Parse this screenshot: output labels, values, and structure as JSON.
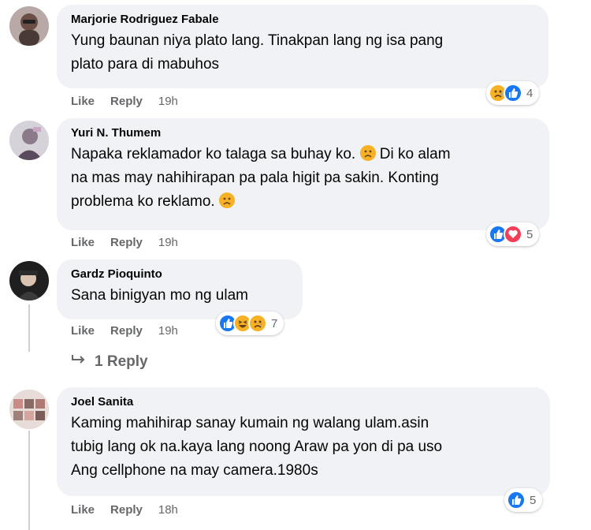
{
  "comments": [
    {
      "author": "Marjorie Rodriguez Fabale",
      "lines": [
        "Yung baunan niya plato lang. Tinakpan lang ng isa pang",
        "plato para di mabuhos"
      ],
      "like_label": "Like",
      "reply_label": "Reply",
      "time": "19h",
      "reactions": [
        "sad",
        "like"
      ],
      "reaction_count": "4"
    },
    {
      "author": "Yuri N. Thumem",
      "lines": [
        "Napaka reklamador ko talaga sa buhay ko.",
        "Di ko alam",
        "na mas may nahihirapan pa pala higit pa sakin. Konting",
        "problema ko reklamo."
      ],
      "like_label": "Like",
      "reply_label": "Reply",
      "time": "19h",
      "reactions": [
        "like",
        "love"
      ],
      "reaction_count": "5"
    },
    {
      "author": "Gardz Pioquinto",
      "lines": [
        "Sana binigyan mo ng ulam"
      ],
      "like_label": "Like",
      "reply_label": "Reply",
      "time": "19h",
      "reactions": [
        "like",
        "haha",
        "sad"
      ],
      "reaction_count": "7",
      "replies_label": "1 Reply"
    },
    {
      "author": "Joel Sanita",
      "lines": [
        "Kaming mahihirap sanay kumain ng walang ulam.asin",
        "tubig lang ok na.kaya lang noong Araw pa yon di pa uso",
        "Ang cellphone na may camera.1980s"
      ],
      "like_label": "Like",
      "reply_label": "Reply",
      "time": "18h",
      "reactions": [
        "like"
      ],
      "reaction_count": "5"
    }
  ],
  "colors": {
    "bubble": "#f0f2f5",
    "meta": "#65676b",
    "like": "#1877f2",
    "love": "#f33e58",
    "emoji_yellow": "#f7b125"
  }
}
